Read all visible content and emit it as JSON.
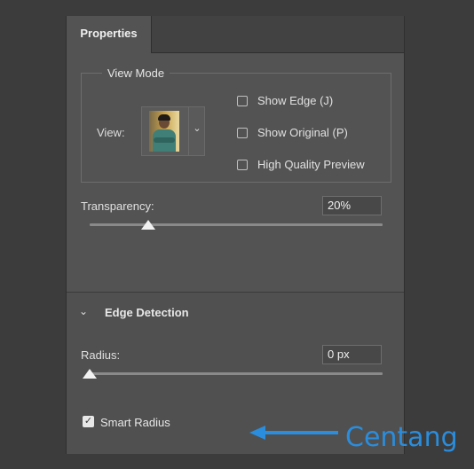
{
  "panel": {
    "tab_label": "Properties"
  },
  "view_mode": {
    "legend": "View Mode",
    "view_label": "View:",
    "checkboxes": [
      {
        "label": "Show Edge (J)",
        "checked": false
      },
      {
        "label": "Show Original (P)",
        "checked": false
      },
      {
        "label": "High Quality Preview",
        "checked": false
      }
    ]
  },
  "transparency": {
    "label": "Transparency:",
    "value": "20%",
    "level": 0.2
  },
  "edge_detection": {
    "title": "Edge Detection",
    "radius_label": "Radius:",
    "radius_value": "0 px",
    "radius_level": 0,
    "smart_radius_label": "Smart Radius",
    "smart_radius_checked": true
  },
  "annotation": {
    "text": "Centang",
    "color": "#2a8ddd"
  }
}
